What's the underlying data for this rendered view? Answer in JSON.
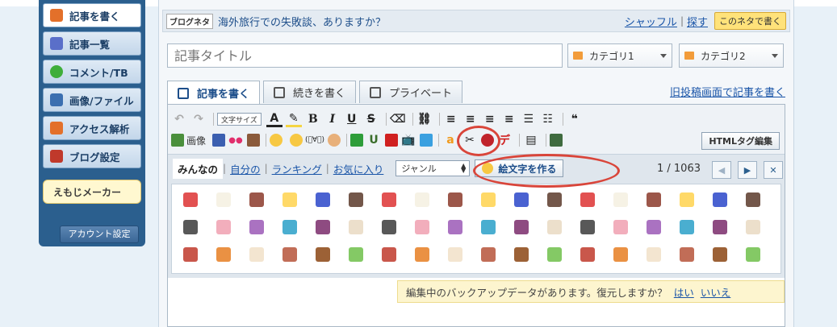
{
  "sidebar": {
    "items": [
      {
        "label": "記事を書く",
        "icon": "pencil-icon",
        "color": "#e3702a"
      },
      {
        "label": "記事一覧",
        "icon": "document-icon",
        "color": "#5a6fc9"
      },
      {
        "label": "コメント/TB",
        "icon": "speech-bubble-icon",
        "color": "#3fae3a"
      },
      {
        "label": "画像/ファイル",
        "icon": "image-icon",
        "color": "#3b6fb0"
      },
      {
        "label": "アクセス解析",
        "icon": "bar-chart-icon",
        "color": "#e3702a"
      },
      {
        "label": "ブログ設定",
        "icon": "wrench-icon",
        "color": "#c0392b"
      }
    ],
    "emoji_maker": "えもじメーカー",
    "account_button": "アカウント設定"
  },
  "neta": {
    "tag": "ブログネタ",
    "question": "海外旅行での失敗談、ありますか？",
    "shuffle": "シャッフル",
    "separator": "|",
    "search": "探す",
    "write_button": "このネタで書く"
  },
  "title_placeholder": "記事タイトル",
  "category1": "カテゴリ1",
  "category2": "カテゴリ2",
  "tabs": [
    {
      "label": "記事を書く"
    },
    {
      "label": "続きを書く"
    },
    {
      "label": "プライベート"
    }
  ],
  "old_editor_link": "旧投稿画面で記事を書く",
  "toolbar": {
    "font_size": "文字サイズ",
    "image_label": "画像",
    "html_button": "HTMLタグ編集"
  },
  "emoji_panel": {
    "tabs": [
      "みんなの",
      "自分の",
      "ランキング",
      "お気に入り"
    ],
    "genre": "ジャンル",
    "make_button": "絵文字を作る",
    "pager": "1 / 1063"
  },
  "notice": {
    "text": "編集中のバックアップデータがあります。復元しますか？",
    "yes": "はい",
    "no": "いいえ"
  }
}
